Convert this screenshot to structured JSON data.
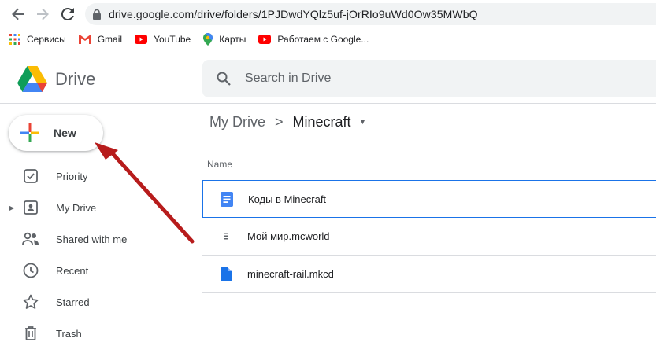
{
  "browser": {
    "url": "drive.google.com/drive/folders/1PJDwdYQlz5uf-jOrRIo9uWd0Ow35MWbQ"
  },
  "bookmarks": [
    {
      "label": "Сервисы",
      "icon": "apps-grid-icon"
    },
    {
      "label": "Gmail",
      "icon": "gmail-icon"
    },
    {
      "label": "YouTube",
      "icon": "youtube-icon"
    },
    {
      "label": "Карты",
      "icon": "maps-icon"
    },
    {
      "label": "Работаем с Google...",
      "icon": "youtube-icon"
    }
  ],
  "header": {
    "app_name": "Drive",
    "search_placeholder": "Search in Drive"
  },
  "sidebar": {
    "new_label": "New",
    "items": [
      {
        "label": "Priority",
        "icon": "priority-icon"
      },
      {
        "label": "My Drive",
        "icon": "my-drive-icon"
      },
      {
        "label": "Shared with me",
        "icon": "shared-icon"
      },
      {
        "label": "Recent",
        "icon": "clock-icon"
      },
      {
        "label": "Starred",
        "icon": "star-icon"
      },
      {
        "label": "Trash",
        "icon": "trash-icon"
      }
    ]
  },
  "main": {
    "breadcrumb": {
      "root": "My Drive",
      "separator": ">",
      "current": "Minecraft"
    },
    "column_name": "Name",
    "files": [
      {
        "name": "Коды в Minecraft",
        "icon": "google-doc-icon",
        "selected": true
      },
      {
        "name": "Мой мир.mcworld",
        "icon": "generic-file-icon",
        "selected": false
      },
      {
        "name": "minecraft-rail.mkcd",
        "icon": "file-icon",
        "selected": false
      }
    ]
  },
  "colors": {
    "accent_blue": "#1a73e8",
    "annotation_arrow": "#b71c1c"
  }
}
